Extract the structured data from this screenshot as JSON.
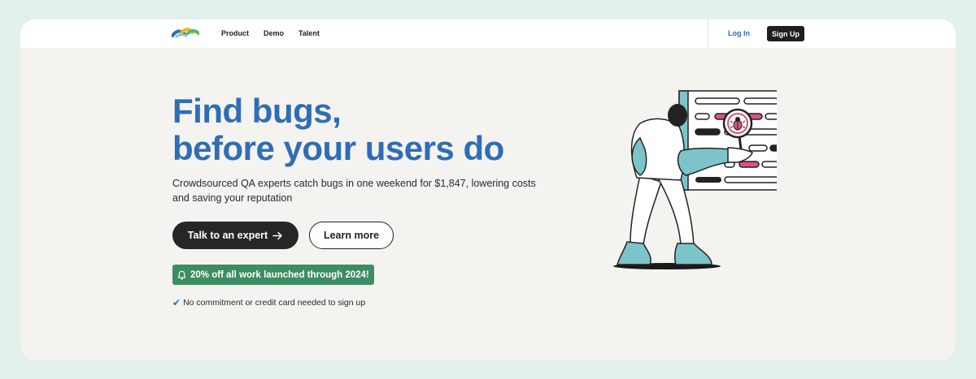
{
  "nav": {
    "logo_icon": "wave-logo-icon",
    "links": [
      "Product",
      "Demo",
      "Talent"
    ],
    "login_label": "Log In",
    "signup_label": "Sign Up"
  },
  "hero": {
    "title_line1": "Find bugs,",
    "title_line2": "before your users do",
    "subtitle": "Crowdsourced QA experts catch bugs in one weekend for $1,847, lowering costs and saving your reputation",
    "primary_button": "Talk to an expert",
    "primary_button_icon": "arrow-right-icon",
    "secondary_button": "Learn more",
    "promo_text": "20% off all work launched through 2024!",
    "promo_icon": "bell-icon",
    "note_text": "No commitment or credit card needed to sign up",
    "note_icon": "checkmark-icon"
  },
  "colors": {
    "accent": "#2f6db5",
    "promo": "#3c8d62",
    "dark": "#262626",
    "page_bg": "#e3f0ec",
    "card_bg": "#f4f3f0"
  },
  "illustration": "person-inspecting-bug-with-magnifier"
}
